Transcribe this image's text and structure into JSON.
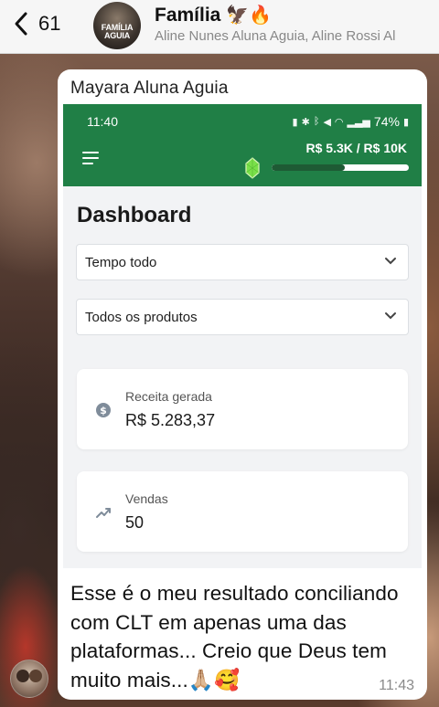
{
  "header": {
    "back_count": "61",
    "group_name": "Família",
    "group_emojis": "🦅🔥",
    "members": "Aline Nunes Aluna Aguia, Aline Rossi Al",
    "avatar_logo_line1": "FAMÍLIA",
    "avatar_logo_line2": "AGUIA"
  },
  "message": {
    "sender": "Mayara Aluna Aguia",
    "text": "Esse é o meu resultado conciliando com CLT em apenas uma das plataformas... Creio que Deus tem muito mais...🙏🏼🥰",
    "time": "11:43"
  },
  "screenshot": {
    "status_time": "11:40",
    "battery": "74%",
    "revenue_goal": "R$ 5.3K / R$ 10K",
    "goal_progress": 0.53,
    "dashboard_title": "Dashboard",
    "period_select": "Tempo todo",
    "product_select": "Todos os produtos",
    "cards": {
      "revenue_label": "Receita gerada",
      "revenue_value": "R$ 5.283,37",
      "sales_label": "Vendas",
      "sales_value": "50"
    },
    "colors": {
      "header_green": "#207f46",
      "progress_dark": "#1e5a34"
    }
  }
}
